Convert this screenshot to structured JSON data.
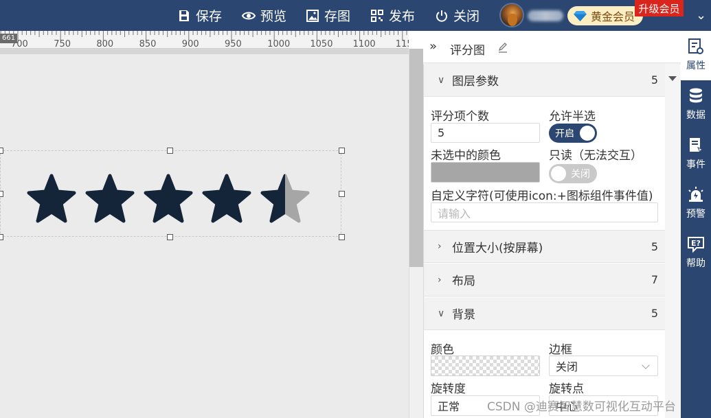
{
  "toolbar": {
    "save": "保存",
    "preview": "预览",
    "save_image": "存图",
    "publish": "发布",
    "close": "关闭",
    "vip_label": "黄金会员",
    "upgrade_label": "升级会员"
  },
  "ruler": {
    "badge": "661",
    "ticks": [
      "700",
      "750",
      "800",
      "850",
      "900",
      "950",
      "1000",
      "1050",
      "1100",
      "115"
    ]
  },
  "canvas": {
    "rating_widget": {
      "total": 5,
      "value": 4.5,
      "filled_color": "#14253a",
      "empty_color": "#a6a6a6"
    }
  },
  "panel": {
    "title": "评分图",
    "sections": {
      "layer": {
        "title": "图层参数",
        "count": "5"
      },
      "position": {
        "title": "位置大小(按屏幕)",
        "count": "5"
      },
      "layout": {
        "title": "布局",
        "count": "7"
      },
      "background": {
        "title": "背景",
        "count": "5"
      }
    },
    "fields": {
      "item_count_label": "评分项个数",
      "item_count_value": "5",
      "half_label": "允许半选",
      "half_toggle": "开启",
      "unselected_color_label": "未选中的颜色",
      "unselected_color": "#a6a6a6",
      "readonly_label": "只读（无法交互）",
      "readonly_toggle": "关闭",
      "custom_char_label": "自定义字符(可使用icon:+图标组件事件值)",
      "custom_char_placeholder": "请输入",
      "bg_color_label": "颜色",
      "border_label": "边框",
      "border_value": "关闭",
      "rotation_label": "旋转度",
      "rotation_value": "正常",
      "pivot_label": "旋转点",
      "pivot_value": "中心"
    }
  },
  "sidenav": {
    "properties": "属性",
    "data": "数据",
    "events": "事件",
    "alerts": "预警",
    "help": "帮助"
  },
  "watermark": "CSDN @迪赛智慧数可视化互动平台",
  "colors": {
    "primary": "#2b4670",
    "star": "#14253a",
    "upgrade": "#d9251c",
    "vip_bg": "#fbeec2"
  }
}
